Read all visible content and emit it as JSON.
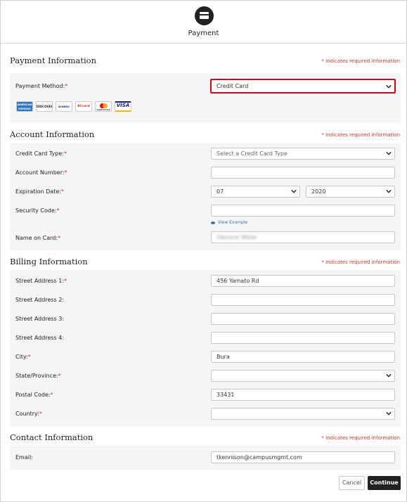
{
  "header": {
    "title": "Payment",
    "icon": "credit-card-icon"
  },
  "required_note": "Indicates required information",
  "payment_info": {
    "title": "Payment Information",
    "method_label": "Payment Method:",
    "method_value": "Credit Card",
    "card_logos": [
      "AMERICAN EXPRESS",
      "DISCOVER",
      "DINERS",
      "BCcard",
      "mastercard",
      "VISA"
    ]
  },
  "account_info": {
    "title": "Account Information",
    "card_type_label": "Credit Card Type:",
    "card_type_value": "Select a Credit Card Type",
    "account_number_label": "Account Number:",
    "account_number_value": "",
    "expiration_label": "Expiration Date:",
    "exp_month": "07",
    "exp_year": "2020",
    "security_code_label": "Security Code:",
    "security_code_value": "",
    "view_example": "View Example",
    "name_label": "Name on Card:",
    "name_value": "Dwyane Wade"
  },
  "billing_info": {
    "title": "Billing Information",
    "street1_label": "Street Address 1:",
    "street1_value": "456 Yamato Rd",
    "street2_label": "Street Address 2:",
    "street2_value": "",
    "street3_label": "Street Address 3:",
    "street3_value": "",
    "street4_label": "Street Address 4:",
    "street4_value": "",
    "city_label": "City:",
    "city_value": "Bura",
    "state_label": "State/Province:",
    "state_value": "",
    "postal_label": "Postal Code:",
    "postal_value": "33431",
    "country_label": "Country:",
    "country_value": ""
  },
  "contact_info": {
    "title": "Contact Information",
    "email_label": "Email:",
    "email_value": "tkennison@campusmgmt.com"
  },
  "actions": {
    "cancel": "Cancel",
    "continue": "Continue"
  },
  "colors": {
    "required": "#c0392b",
    "highlight": "#d0021b",
    "primary": "#222222",
    "panel": "#f4f5f7"
  }
}
